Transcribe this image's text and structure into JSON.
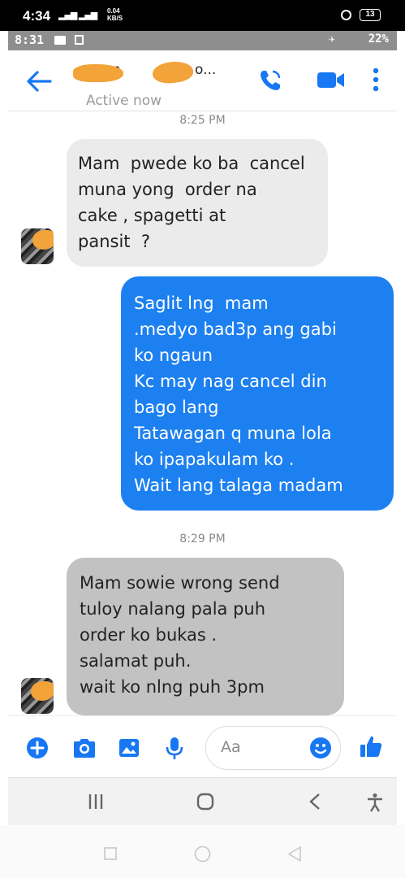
{
  "device": {
    "time": "4:34",
    "net_speed_value": "0.04",
    "net_speed_unit": "KB/S",
    "battery": "13"
  },
  "screenshot": {
    "status_time": "8:31",
    "battery_percent": "22%"
  },
  "header": {
    "contact_name_visible": "n",
    "contact_name_tail": "o...",
    "status": "Active now"
  },
  "messages": [
    {
      "timestamp": "8:25 PM"
    },
    {
      "sender": "contact",
      "text": "Mam  pwede ko ba  cancel\nmuna yong  order na\ncake , spagetti at\npansit  ?"
    },
    {
      "sender": "me",
      "text": "Saglit lng  mam\n.medyo bad3p ang gabi\nko ngaun\nKc may nag cancel din\nbago lang\nTatawagan q muna lola\nko ipapakulam ko .\nWait lang talaga madam"
    },
    {
      "timestamp": "8:29 PM"
    },
    {
      "sender": "contact",
      "text": "Mam sowie wrong send\ntuloy nalang pala puh\norder ko bukas .\nsalamat puh.\nwait ko nlng puh 3pm"
    }
  ],
  "compose": {
    "placeholder": "Aa"
  },
  "colors": {
    "accent": "#1877f2",
    "sent_bubble": "#1d80f0",
    "received_bubble": "#ebebeb",
    "censor": "#f2a33a"
  }
}
